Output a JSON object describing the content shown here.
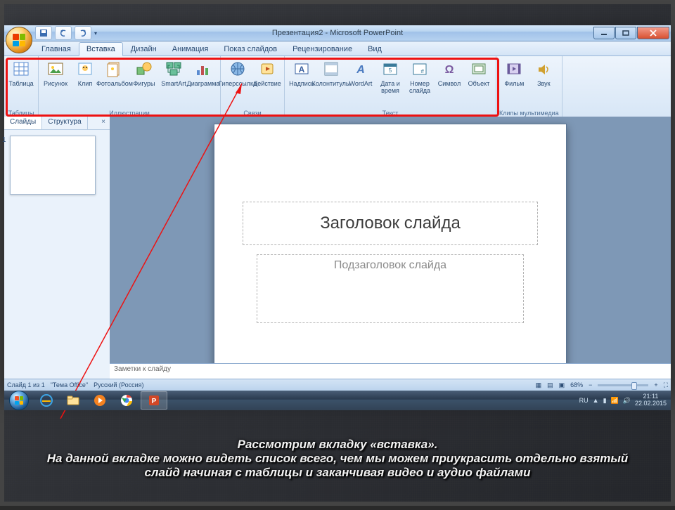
{
  "title": "Презентация2 - Microsoft PowerPoint",
  "tabs": [
    "Главная",
    "Вставка",
    "Дизайн",
    "Анимация",
    "Показ слайдов",
    "Рецензирование",
    "Вид"
  ],
  "active_tab": 1,
  "ribbon": {
    "groups": [
      {
        "label": "Таблицы",
        "buttons": [
          {
            "name": "table",
            "label": "Таблица"
          }
        ]
      },
      {
        "label": "Иллюстрации",
        "buttons": [
          {
            "name": "picture",
            "label": "Рисунок"
          },
          {
            "name": "clip",
            "label": "Клип"
          },
          {
            "name": "photoalbum",
            "label": "Фотоальбом"
          },
          {
            "name": "shapes",
            "label": "Фигуры"
          },
          {
            "name": "smartart",
            "label": "SmartArt"
          },
          {
            "name": "chart",
            "label": "Диаграмма"
          }
        ]
      },
      {
        "label": "Связи",
        "buttons": [
          {
            "name": "hyperlink",
            "label": "Гиперссылка"
          },
          {
            "name": "action",
            "label": "Действие"
          }
        ]
      },
      {
        "label": "Текст",
        "buttons": [
          {
            "name": "textbox",
            "label": "Надпись"
          },
          {
            "name": "headerfooter",
            "label": "Колонтитулы"
          },
          {
            "name": "wordart",
            "label": "WordArt"
          },
          {
            "name": "datetime",
            "label": "Дата и время"
          },
          {
            "name": "slidenum",
            "label": "Номер слайда"
          },
          {
            "name": "symbol",
            "label": "Символ"
          },
          {
            "name": "object",
            "label": "Объект"
          }
        ]
      },
      {
        "label": "Клипы мультимедиа",
        "buttons": [
          {
            "name": "movie",
            "label": "Фильм"
          },
          {
            "name": "sound",
            "label": "Звук"
          }
        ]
      }
    ]
  },
  "leftpane": {
    "tabs": [
      "Слайды",
      "Структура"
    ]
  },
  "slide": {
    "title": "Заголовок слайда",
    "subtitle": "Подзаголовок слайда"
  },
  "notes_placeholder": "Заметки к слайду",
  "status": {
    "slide": "Слайд 1 из 1",
    "theme": "\"Тема Office\"",
    "lang": "Русский (Россия)",
    "zoom": "68%"
  },
  "taskbar": {
    "lang": "RU",
    "time": "21:11",
    "date": "22.02.2015"
  },
  "caption": {
    "line1": "Рассмотрим вкладку «вставка».",
    "line2": "На данной вкладке можно видеть список всего, чем мы можем приукрасить отдельно взятый слайд начиная с таблицы и заканчивая видео и аудио файлами"
  },
  "icons": {
    "table": "#5a8bd0",
    "picture": "#e2b23a",
    "clip": "#6aa5d8",
    "photoalbum": "#c28a3e",
    "shapes": "#4a9e4a",
    "smartart": "#3a8a5a",
    "chart": "#c05050",
    "hyperlink": "#4a7ac0",
    "action": "#d0a030",
    "textbox": "#3a60a0",
    "headerfooter": "#6a8aa0",
    "wordart": "#4a7ac0",
    "datetime": "#3a7a9a",
    "slidenum": "#3a7a9a",
    "symbol": "#7a5aa0",
    "object": "#5a8a5a",
    "movie": "#8a6ac0",
    "sound": "#d0a030"
  }
}
